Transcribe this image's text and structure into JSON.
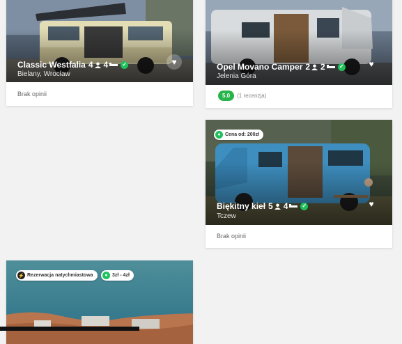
{
  "cards": [
    {
      "title": "Classic Westfalia",
      "persons": "4",
      "beds": "4",
      "location": "Bielany, Wrocław",
      "review_text": "Brak opinii",
      "heart_icon": "heart-icon"
    },
    {
      "title": "Opel Movano Camper",
      "persons": "2",
      "beds": "2",
      "location": "Jelenia Góra",
      "rating_value": "5.0",
      "rating_count": "(1 recenzja)",
      "heart_icon": "heart-icon"
    },
    {
      "title": "Biękitny kieł",
      "persons": "5",
      "beds": "4",
      "location": "Tczew",
      "price_pill": "Cena od: 200zł",
      "review_text": "Brak opinii",
      "heart_icon": "heart-icon"
    },
    {
      "instant_pill": "Rezerwacja natychmiastowa",
      "price_pill": "3zł - 4zł"
    }
  ],
  "colors": {
    "accent_green": "#1fc15b",
    "rating_green": "#27b44a"
  },
  "icons": [
    "user-icon",
    "bed-icon",
    "verified-check-icon",
    "heart-icon",
    "tag-icon",
    "bolt-icon"
  ]
}
